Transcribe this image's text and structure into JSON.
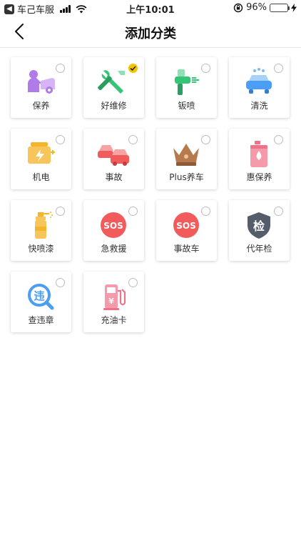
{
  "status_bar": {
    "back_app": "车己车服",
    "time": "上午10:01",
    "battery": "96%",
    "battery_level": 0.96
  },
  "nav": {
    "title": "添加分类"
  },
  "categories": [
    {
      "label": "保养",
      "icon": "car-maintenance-icon",
      "checked": false
    },
    {
      "label": "好维修",
      "icon": "repair-tools-icon",
      "checked": true
    },
    {
      "label": "钣喷",
      "icon": "spray-gun-icon",
      "checked": false
    },
    {
      "label": "清洗",
      "icon": "car-wash-icon",
      "checked": false
    },
    {
      "label": "机电",
      "icon": "engine-icon",
      "checked": false
    },
    {
      "label": "事故",
      "icon": "car-accident-icon",
      "checked": false
    },
    {
      "label": "Plus养车",
      "icon": "crown-icon",
      "checked": false
    },
    {
      "label": "惠保养",
      "icon": "oil-can-icon",
      "checked": false
    },
    {
      "label": "快喷漆",
      "icon": "spray-bottle-icon",
      "checked": false
    },
    {
      "label": "急救援",
      "icon": "sos-icon",
      "checked": false
    },
    {
      "label": "事故车",
      "icon": "sos-icon",
      "checked": false
    },
    {
      "label": "代年检",
      "icon": "inspection-shield-icon",
      "checked": false
    },
    {
      "label": "查违章",
      "icon": "violation-search-icon",
      "checked": false
    },
    {
      "label": "充油卡",
      "icon": "fuel-pump-icon",
      "checked": false
    }
  ],
  "colors": {
    "accent": "#f5c400",
    "purple": "#b07be8",
    "green": "#36c477",
    "blue": "#4a9ef5",
    "orange": "#f5b52a",
    "red": "#f25b5b",
    "brown": "#b77a4d",
    "pink": "#f07289",
    "gray": "#555d6b"
  },
  "icon_text": {
    "sos": "SOS",
    "inspection": "检",
    "violation": "违",
    "currency": "¥"
  }
}
